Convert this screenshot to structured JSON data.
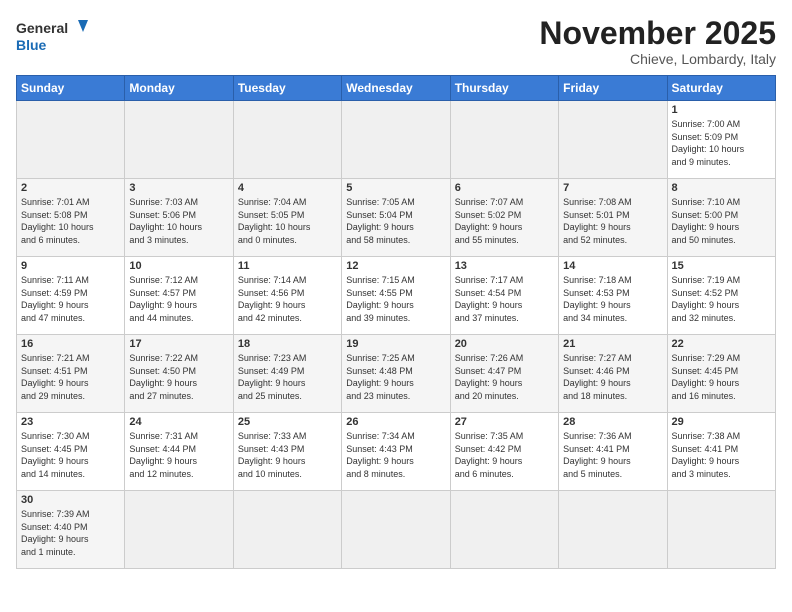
{
  "header": {
    "logo_general": "General",
    "logo_blue": "Blue",
    "month_title": "November 2025",
    "location": "Chieve, Lombardy, Italy"
  },
  "days_of_week": [
    "Sunday",
    "Monday",
    "Tuesday",
    "Wednesday",
    "Thursday",
    "Friday",
    "Saturday"
  ],
  "weeks": [
    [
      {
        "num": "",
        "info": ""
      },
      {
        "num": "",
        "info": ""
      },
      {
        "num": "",
        "info": ""
      },
      {
        "num": "",
        "info": ""
      },
      {
        "num": "",
        "info": ""
      },
      {
        "num": "",
        "info": ""
      },
      {
        "num": "1",
        "info": "Sunrise: 7:00 AM\nSunset: 5:09 PM\nDaylight: 10 hours\nand 9 minutes."
      }
    ],
    [
      {
        "num": "2",
        "info": "Sunrise: 7:01 AM\nSunset: 5:08 PM\nDaylight: 10 hours\nand 6 minutes."
      },
      {
        "num": "3",
        "info": "Sunrise: 7:03 AM\nSunset: 5:06 PM\nDaylight: 10 hours\nand 3 minutes."
      },
      {
        "num": "4",
        "info": "Sunrise: 7:04 AM\nSunset: 5:05 PM\nDaylight: 10 hours\nand 0 minutes."
      },
      {
        "num": "5",
        "info": "Sunrise: 7:05 AM\nSunset: 5:04 PM\nDaylight: 9 hours\nand 58 minutes."
      },
      {
        "num": "6",
        "info": "Sunrise: 7:07 AM\nSunset: 5:02 PM\nDaylight: 9 hours\nand 55 minutes."
      },
      {
        "num": "7",
        "info": "Sunrise: 7:08 AM\nSunset: 5:01 PM\nDaylight: 9 hours\nand 52 minutes."
      },
      {
        "num": "8",
        "info": "Sunrise: 7:10 AM\nSunset: 5:00 PM\nDaylight: 9 hours\nand 50 minutes."
      }
    ],
    [
      {
        "num": "9",
        "info": "Sunrise: 7:11 AM\nSunset: 4:59 PM\nDaylight: 9 hours\nand 47 minutes."
      },
      {
        "num": "10",
        "info": "Sunrise: 7:12 AM\nSunset: 4:57 PM\nDaylight: 9 hours\nand 44 minutes."
      },
      {
        "num": "11",
        "info": "Sunrise: 7:14 AM\nSunset: 4:56 PM\nDaylight: 9 hours\nand 42 minutes."
      },
      {
        "num": "12",
        "info": "Sunrise: 7:15 AM\nSunset: 4:55 PM\nDaylight: 9 hours\nand 39 minutes."
      },
      {
        "num": "13",
        "info": "Sunrise: 7:17 AM\nSunset: 4:54 PM\nDaylight: 9 hours\nand 37 minutes."
      },
      {
        "num": "14",
        "info": "Sunrise: 7:18 AM\nSunset: 4:53 PM\nDaylight: 9 hours\nand 34 minutes."
      },
      {
        "num": "15",
        "info": "Sunrise: 7:19 AM\nSunset: 4:52 PM\nDaylight: 9 hours\nand 32 minutes."
      }
    ],
    [
      {
        "num": "16",
        "info": "Sunrise: 7:21 AM\nSunset: 4:51 PM\nDaylight: 9 hours\nand 29 minutes."
      },
      {
        "num": "17",
        "info": "Sunrise: 7:22 AM\nSunset: 4:50 PM\nDaylight: 9 hours\nand 27 minutes."
      },
      {
        "num": "18",
        "info": "Sunrise: 7:23 AM\nSunset: 4:49 PM\nDaylight: 9 hours\nand 25 minutes."
      },
      {
        "num": "19",
        "info": "Sunrise: 7:25 AM\nSunset: 4:48 PM\nDaylight: 9 hours\nand 23 minutes."
      },
      {
        "num": "20",
        "info": "Sunrise: 7:26 AM\nSunset: 4:47 PM\nDaylight: 9 hours\nand 20 minutes."
      },
      {
        "num": "21",
        "info": "Sunrise: 7:27 AM\nSunset: 4:46 PM\nDaylight: 9 hours\nand 18 minutes."
      },
      {
        "num": "22",
        "info": "Sunrise: 7:29 AM\nSunset: 4:45 PM\nDaylight: 9 hours\nand 16 minutes."
      }
    ],
    [
      {
        "num": "23",
        "info": "Sunrise: 7:30 AM\nSunset: 4:45 PM\nDaylight: 9 hours\nand 14 minutes."
      },
      {
        "num": "24",
        "info": "Sunrise: 7:31 AM\nSunset: 4:44 PM\nDaylight: 9 hours\nand 12 minutes."
      },
      {
        "num": "25",
        "info": "Sunrise: 7:33 AM\nSunset: 4:43 PM\nDaylight: 9 hours\nand 10 minutes."
      },
      {
        "num": "26",
        "info": "Sunrise: 7:34 AM\nSunset: 4:43 PM\nDaylight: 9 hours\nand 8 minutes."
      },
      {
        "num": "27",
        "info": "Sunrise: 7:35 AM\nSunset: 4:42 PM\nDaylight: 9 hours\nand 6 minutes."
      },
      {
        "num": "28",
        "info": "Sunrise: 7:36 AM\nSunset: 4:41 PM\nDaylight: 9 hours\nand 5 minutes."
      },
      {
        "num": "29",
        "info": "Sunrise: 7:38 AM\nSunset: 4:41 PM\nDaylight: 9 hours\nand 3 minutes."
      }
    ],
    [
      {
        "num": "30",
        "info": "Sunrise: 7:39 AM\nSunset: 4:40 PM\nDaylight: 9 hours\nand 1 minute."
      },
      {
        "num": "",
        "info": ""
      },
      {
        "num": "",
        "info": ""
      },
      {
        "num": "",
        "info": ""
      },
      {
        "num": "",
        "info": ""
      },
      {
        "num": "",
        "info": ""
      },
      {
        "num": "",
        "info": ""
      }
    ]
  ]
}
